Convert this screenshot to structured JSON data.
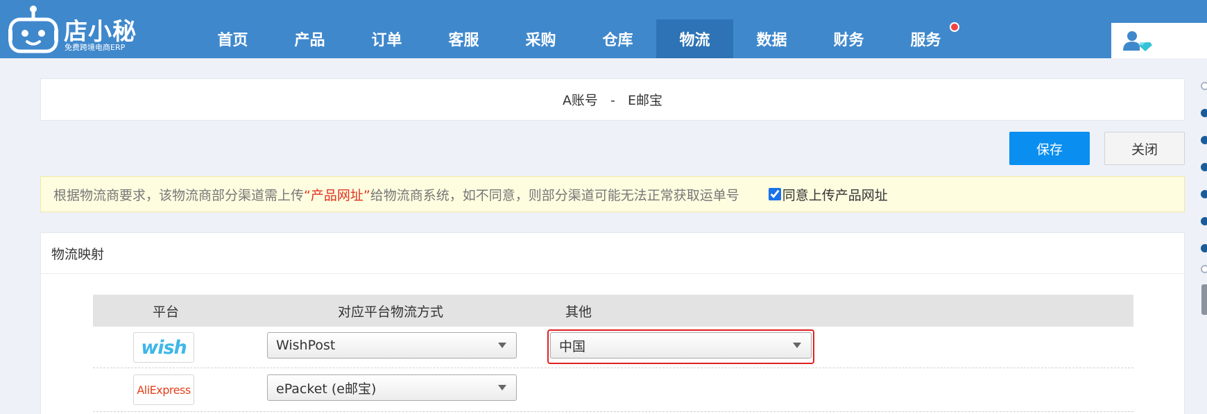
{
  "app": {
    "logo_name": "店小秘",
    "logo_subtitle": "免费跨境电商ERP"
  },
  "nav": {
    "items": [
      {
        "label": "首页"
      },
      {
        "label": "产品"
      },
      {
        "label": "订单"
      },
      {
        "label": "客服"
      },
      {
        "label": "采购"
      },
      {
        "label": "仓库"
      },
      {
        "label": "物流",
        "active": true
      },
      {
        "label": "数据"
      },
      {
        "label": "财务"
      },
      {
        "label": "服务",
        "badge_dot": true
      }
    ]
  },
  "page": {
    "title": "A账号   -   E邮宝"
  },
  "actions": {
    "save_label": "保存",
    "close_label": "关闭"
  },
  "notice": {
    "text_before": "根据物流商要求，该物流商部分渠道需上传",
    "highlight": "“产品网址”",
    "text_after": "给物流商系统，如不同意，则部分渠道可能无法正常获取运单号",
    "agree_label": "同意上传产品网址",
    "agree_checked": true
  },
  "mapping": {
    "section_title": "物流映射",
    "columns": {
      "platform": "平台",
      "method": "对应平台物流方式",
      "other": "其他"
    },
    "rows": [
      {
        "platform": "wish",
        "method": "WishPost",
        "other": "中国"
      },
      {
        "platform": "AliExpress",
        "method": "ePacket (e邮宝)",
        "other": ""
      }
    ]
  },
  "colors": {
    "header_bg": "#3f88cc",
    "nav_active_bg": "#2e73b5",
    "primary_button": "#0a8ff0",
    "notice_bg": "#fffde0",
    "notice_highlight": "#e0321e",
    "selection_outline": "#e02020"
  },
  "icons": {
    "logo": "robot-icon",
    "user": "user-gem-icon",
    "dropdown": "triangle-down-icon"
  }
}
